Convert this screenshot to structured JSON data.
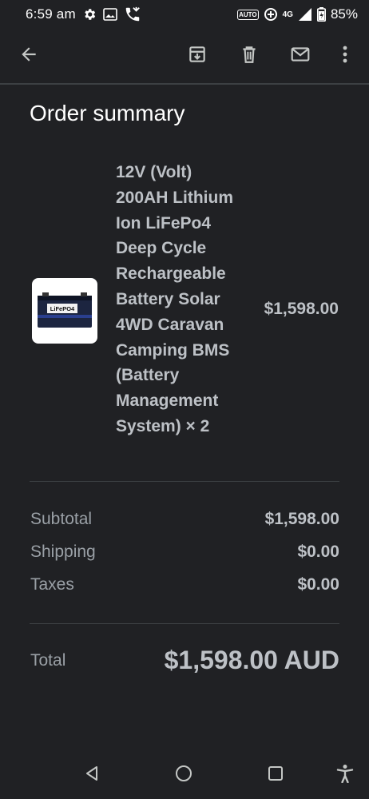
{
  "status_bar": {
    "time": "6:59 am",
    "auto_tag": "AUTO",
    "network": "4G",
    "battery": "85%"
  },
  "toolbar": {
    "icons": [
      "back-arrow-icon",
      "archive-icon",
      "delete-icon",
      "mail-icon",
      "more-vert-icon"
    ]
  },
  "order": {
    "title": "Order summary",
    "product": {
      "name": "12V (Volt) 200AH Lithium Ion LiFePo4 Deep Cycle Rechargeable Battery Solar 4WD Caravan Camping BMS (Battery Management System) × 2",
      "image_label": "LiFePO4",
      "price": "$1,598.00"
    },
    "subtotal_label": "Subtotal",
    "subtotal_value": "$1,598.00",
    "shipping_label": "Shipping",
    "shipping_value": "$0.00",
    "taxes_label": "Taxes",
    "taxes_value": "$0.00",
    "total_label": "Total",
    "total_value": "$1,598.00 AUD"
  },
  "nav_bar": {
    "icons": [
      "back-triangle-icon",
      "home-circle-icon",
      "recents-square-icon",
      "accessibility-icon"
    ]
  }
}
